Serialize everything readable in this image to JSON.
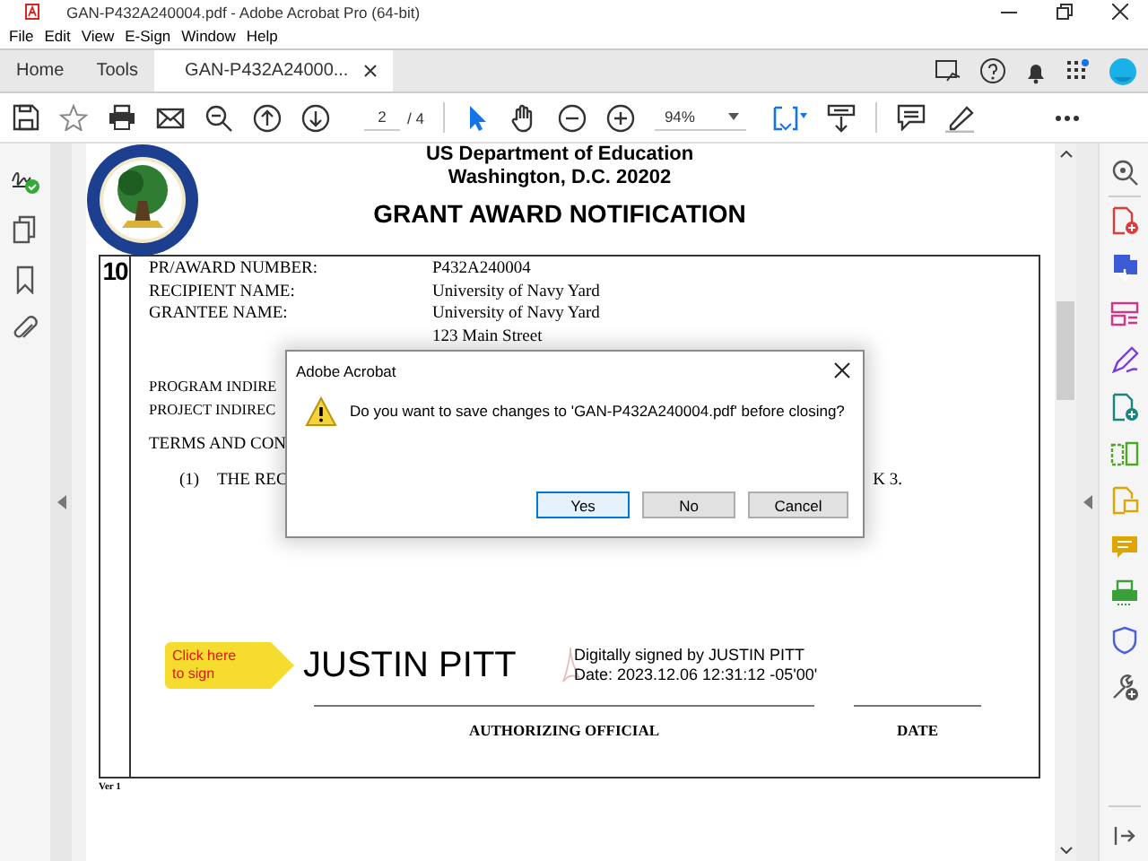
{
  "window": {
    "title": "GAN-P432A240004.pdf - Adobe Acrobat Pro (64-bit)"
  },
  "menu": [
    "File",
    "Edit",
    "View",
    "E-Sign",
    "Window",
    "Help"
  ],
  "tabs": [
    {
      "label": "Home",
      "kind": "nav",
      "selected": false
    },
    {
      "label": "Tools",
      "kind": "nav",
      "selected": false
    },
    {
      "label": "GAN-P432A24000...",
      "kind": "document",
      "selected": true
    }
  ],
  "toolbar": {
    "page": "2",
    "page_count": "/ 4",
    "zoom": "94%"
  },
  "document": {
    "header": [
      "US Department of Education",
      "Washington, D.C. 20202"
    ],
    "title": "GRANT AWARD NOTIFICATION",
    "box_number": "10",
    "fields": [
      {
        "label": "PR/AWARD NUMBER:",
        "value": "P432A240004"
      },
      {
        "label": "RECIPIENT NAME:",
        "value": "University of Navy Yard"
      },
      {
        "label": "GRANTEE NAME:",
        "value": "University of Navy Yard"
      }
    ],
    "address": "123 Main Street",
    "indirect_lines": [
      "PROGRAM INDIRE",
      "PROJECT INDIREC"
    ],
    "terms_heading": "TERMS AND CON",
    "term": {
      "number": "(1)",
      "text_start": "THE REC",
      "text_end": "K 3."
    },
    "sign_here": "Click here to sign",
    "signer": "JUSTIN PITT",
    "digital_signature": [
      "Digitally signed by JUSTIN PITT",
      "Date: 2023.12.06 12:31:12 -05'00'"
    ],
    "signature_labels": [
      "AUTHORIZING OFFICIAL",
      "DATE"
    ],
    "footer": "Ver 1"
  },
  "dialog": {
    "title": "Adobe Acrobat",
    "message": "Do you want to save changes to 'GAN-P432A240004.pdf' before closing?",
    "buttons": [
      {
        "label": "Yes",
        "selected": true
      },
      {
        "label": "No",
        "selected": false
      },
      {
        "label": "Cancel",
        "selected": false
      }
    ]
  }
}
